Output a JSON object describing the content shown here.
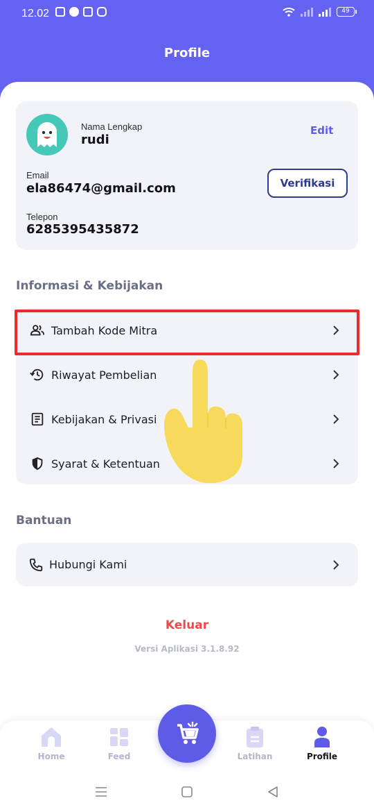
{
  "status_bar": {
    "time": "12.02",
    "battery": "49"
  },
  "header": {
    "title": "Profile"
  },
  "profile": {
    "name_label": "Nama Lengkap",
    "name": "rudi",
    "edit_label": "Edit",
    "email_label": "Email",
    "email": "ela86474@gmail.com",
    "verify_label": "Verifikasi",
    "phone_label": "Telepon",
    "phone": "6285395435872"
  },
  "sections": {
    "info_title": "Informasi & Kebijakan",
    "info_items": [
      {
        "label": "Tambah Kode Mitra",
        "icon": "people-icon"
      },
      {
        "label": "Riwayat Pembelian",
        "icon": "history-icon"
      },
      {
        "label": "Kebijakan & Privasi",
        "icon": "document-icon"
      },
      {
        "label": "Syarat & Ketentuan",
        "icon": "shield-icon"
      }
    ],
    "help_title": "Bantuan",
    "help_items": [
      {
        "label": "Hubungi Kami",
        "icon": "phone-icon"
      }
    ]
  },
  "logout_label": "Keluar",
  "version": "Versi Aplikasi  3.1.8.92",
  "bottom_nav": [
    {
      "label": "Home",
      "icon": "home-icon",
      "active": false
    },
    {
      "label": "Feed",
      "icon": "grid-icon",
      "active": false
    },
    {
      "label": "",
      "icon": "cart-icon",
      "active": false
    },
    {
      "label": "Latihan",
      "icon": "clipboard-icon",
      "active": false
    },
    {
      "label": "Profile",
      "icon": "person-icon",
      "active": true
    }
  ],
  "colors": {
    "accent": "#5e5ce6",
    "header_bg": "#6462f0",
    "card_bg": "#f2f3f8",
    "logout": "#ef4a4a",
    "highlight": "#ee2b2b",
    "avatar_bg": "#45c8b8"
  }
}
